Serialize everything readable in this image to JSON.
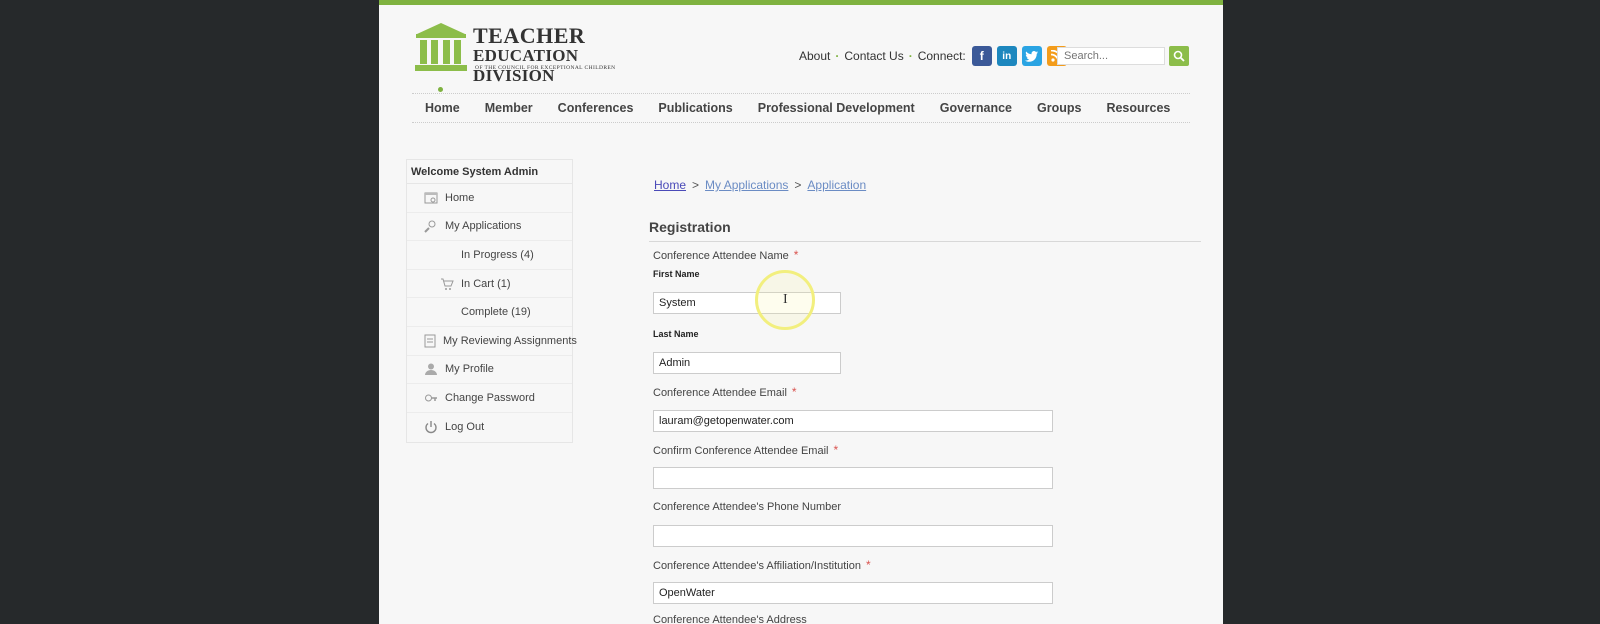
{
  "logo": {
    "line1": "TEACHER",
    "line2": "EDUCATION DIVISION",
    "line3": "of the Council for Exceptional Children"
  },
  "util": {
    "about": "About",
    "contact": "Contact Us",
    "connect": "Connect:",
    "search_placeholder": "Search..."
  },
  "social": [
    "f",
    "in",
    "t",
    "rss"
  ],
  "nav": [
    "Home",
    "Member",
    "Conferences",
    "Publications",
    "Professional Development",
    "Governance",
    "Groups",
    "Resources"
  ],
  "sidebar": {
    "welcome": "Welcome System Admin",
    "items": [
      {
        "label": "Home",
        "icon": "home-icon"
      },
      {
        "label": "My Applications",
        "icon": "applications-icon"
      },
      {
        "label": "In Progress (4)"
      },
      {
        "label": "In Cart (1)",
        "icon": "cart-icon"
      },
      {
        "label": "Complete (19)"
      },
      {
        "label": "My Reviewing Assignments",
        "icon": "clipboard-icon"
      },
      {
        "label": "My Profile",
        "icon": "user-icon"
      },
      {
        "label": "Change Password",
        "icon": "key-icon"
      },
      {
        "label": "Log Out",
        "icon": "power-icon"
      }
    ]
  },
  "breadcrumb": {
    "home": "Home",
    "apps": "My Applications",
    "current": "Application"
  },
  "form": {
    "section": "Registration",
    "name_label": "Conference Attendee Name",
    "first_name_label": "First Name",
    "first_name_value": "System",
    "last_name_label": "Last Name",
    "last_name_value": "Admin",
    "email_label": "Conference Attendee Email",
    "email_value": "lauram@getopenwater.com",
    "confirm_email_label": "Confirm Conference Attendee Email",
    "confirm_email_value": "",
    "phone_label": "Conference Attendee's Phone Number",
    "phone_value": "",
    "affiliation_label": "Conference Attendee's Affiliation/Institution",
    "affiliation_value": "OpenWater",
    "address_label": "Conference Attendee's Address",
    "required_mark": "*"
  }
}
